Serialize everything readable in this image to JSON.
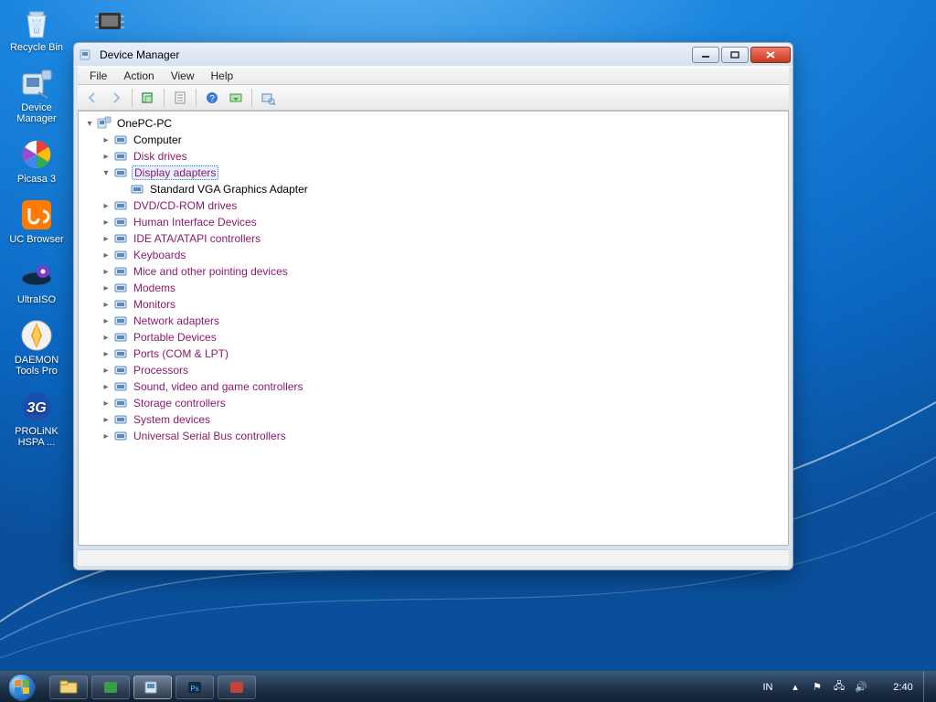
{
  "desktop_icons": [
    {
      "id": "recycle-bin",
      "label": "Recycle Bin"
    },
    {
      "id": "device-manager",
      "label": "Device\nManager"
    },
    {
      "id": "picasa3",
      "label": "Picasa 3"
    },
    {
      "id": "uc-browser",
      "label": "UC Browser"
    },
    {
      "id": "ultraiso",
      "label": "UltraISO"
    },
    {
      "id": "daemon-tools",
      "label": "DAEMON\nTools Pro"
    },
    {
      "id": "prolink",
      "label": "PROLiNK\nHSPA ..."
    }
  ],
  "window": {
    "title": "Device Manager",
    "menubar": [
      "File",
      "Action",
      "View",
      "Help"
    ],
    "toolbar": [
      "back",
      "forward",
      "|",
      "show-hidden",
      "|",
      "properties",
      "|",
      "help",
      "update",
      "|",
      "scan-hardware"
    ]
  },
  "tree": {
    "root": {
      "label": "OnePC-PC"
    },
    "nodes": [
      {
        "label": "Computer",
        "visited": false
      },
      {
        "label": "Disk drives",
        "visited": true
      },
      {
        "label": "Display adapters",
        "visited": true,
        "expanded": true,
        "selected": true,
        "children": [
          {
            "label": "Standard VGA Graphics Adapter"
          }
        ]
      },
      {
        "label": "DVD/CD-ROM drives",
        "visited": true
      },
      {
        "label": "Human Interface Devices",
        "visited": true
      },
      {
        "label": "IDE ATA/ATAPI controllers",
        "visited": true
      },
      {
        "label": "Keyboards",
        "visited": true
      },
      {
        "label": "Mice and other pointing devices",
        "visited": true
      },
      {
        "label": "Modems",
        "visited": true
      },
      {
        "label": "Monitors",
        "visited": true
      },
      {
        "label": "Network adapters",
        "visited": true
      },
      {
        "label": "Portable Devices",
        "visited": true
      },
      {
        "label": "Ports (COM & LPT)",
        "visited": true
      },
      {
        "label": "Processors",
        "visited": true
      },
      {
        "label": "Sound, video and game controllers",
        "visited": true
      },
      {
        "label": "Storage controllers",
        "visited": true
      },
      {
        "label": "System devices",
        "visited": true
      },
      {
        "label": "Universal Serial Bus controllers",
        "visited": true
      }
    ]
  },
  "taskbar": {
    "pinned_count": 5,
    "language": "IN",
    "clock": "2:40"
  }
}
